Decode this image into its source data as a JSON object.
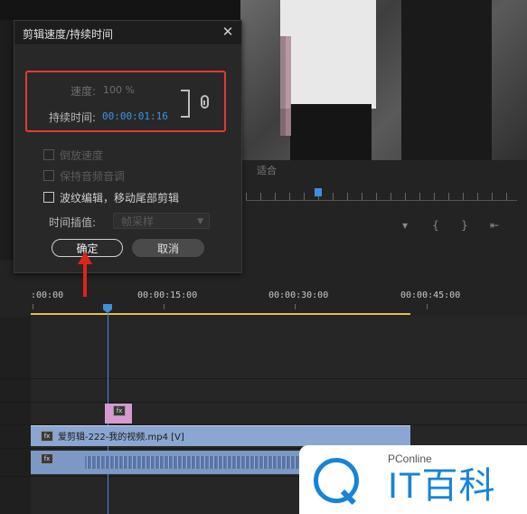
{
  "dialog": {
    "title": "剪辑速度/持续时间",
    "close_glyph": "✕",
    "speed_label": "速度:",
    "speed_value": "100 %",
    "duration_label": "持续时间:",
    "duration_value": "00:00:01:16",
    "options": [
      {
        "label": "倒放速度",
        "checked": false,
        "enabled": false
      },
      {
        "label": "保持音频音调",
        "checked": false,
        "enabled": false
      },
      {
        "label": "波纹编辑，移动尾部剪辑",
        "checked": false,
        "enabled": true
      }
    ],
    "interpolation_label": "时间插值:",
    "interpolation_value": "帧采样",
    "ok_label": "确定",
    "cancel_label": "取消"
  },
  "monitor": {
    "fit_value": "适合"
  },
  "timeline": {
    "timecodes": [
      ":00:00",
      "00:00:15:00",
      "00:00:30:00",
      "00:00:45:00"
    ],
    "video_clip_name": "爱剪辑-222-我的视频.mp4 [V]",
    "fx_badge": "fx"
  },
  "watermark": {
    "brand": "PConline",
    "name": "IT百科"
  },
  "colors": {
    "accent_blue": "#3c93e5",
    "highlight_red": "#e23a34",
    "timeline_yellow": "#e2c43a",
    "video_clip": "#8aa6d1"
  }
}
